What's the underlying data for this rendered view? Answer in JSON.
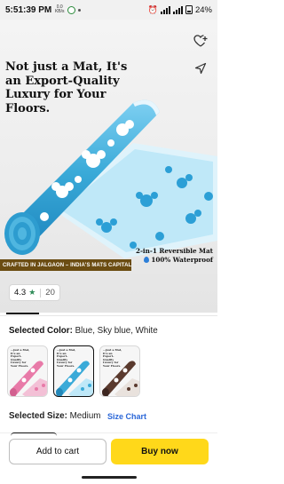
{
  "status_bar": {
    "time": "5:51:39 PM",
    "net_speed": "0.0 KB/s",
    "battery": "24%"
  },
  "product": {
    "headline": "Not just a Mat, It's an Export-Quality Luxury for Your Floors.",
    "banner": "CRAFTED IN JALGAON – INDIA'S MATS CAPITAL",
    "feature_1": "2-in-1 Reversible Mat",
    "feature_2": "100% Waterproof",
    "rating": "4.3",
    "rating_count": "20"
  },
  "variants": {
    "color_label": "Selected Color:",
    "color_value": "Blue, Sky blue, White",
    "swatches": [
      {
        "name": "pink",
        "text": "...just a Mat, It's an Export-Quality Luxury for Your Floors.",
        "color": "#e87aa8"
      },
      {
        "name": "blue",
        "text": "...just a Mat, It's an Export-Quality Luxury for Your Floors.",
        "color": "#3aaad8"
      },
      {
        "name": "brown",
        "text": "...just a Mat, It's an Export-Quality Luxury for Your Floors.",
        "color": "#5a3a2e"
      }
    ],
    "size_label": "Selected Size:",
    "size_value": "Medium",
    "size_chart": "Size Chart"
  },
  "actions": {
    "add_to_cart": "Add to cart",
    "buy_now": "Buy now"
  },
  "colors": {
    "accent_blue": "#2b67d8",
    "buy_yellow": "#ffd81a",
    "rating_green": "#2e8b57",
    "banner_brown": "#6b4c12"
  }
}
